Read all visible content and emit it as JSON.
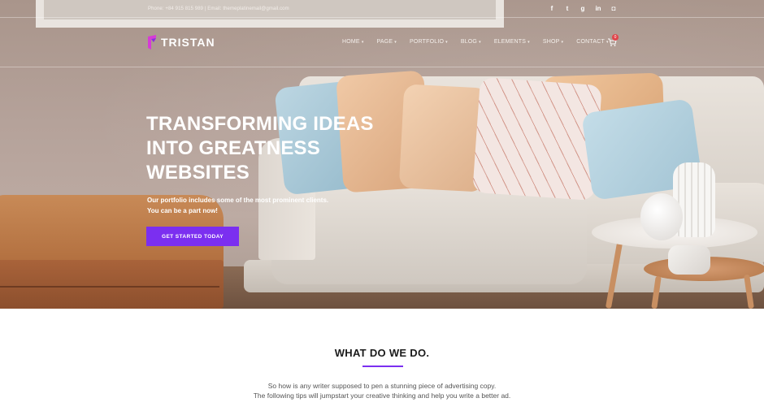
{
  "topbar": {
    "contact": "Phone: +84 915 815 989 | Email: themeplatinemail@gmail.com",
    "socials": [
      {
        "icon": "facebook-icon",
        "glyph": "f"
      },
      {
        "icon": "twitter-icon",
        "glyph": "t"
      },
      {
        "icon": "google-plus-icon",
        "glyph": "g"
      },
      {
        "icon": "linkedin-icon",
        "glyph": "in"
      },
      {
        "icon": "instagram-icon",
        "glyph": "◘"
      }
    ]
  },
  "brand": {
    "name": "TRISTAN",
    "accent": "#7b2ff0",
    "logo_color": "#d63bd6"
  },
  "nav": {
    "items": [
      "HOME",
      "PAGE",
      "PORTFOLIO",
      "BLOG",
      "ELEMENTS",
      "SHOP",
      "CONTACT"
    ],
    "caret": "▾",
    "cart_count": "0"
  },
  "hero": {
    "title_lines": [
      "TRANSFORMING IDEAS",
      "INTO GREATNESS",
      "WEBSITES"
    ],
    "subtitle_lines": [
      "Our portfolio includes some of the most prominent clients.",
      "You can be a part now!"
    ],
    "cta": "GET STARTED TODAY"
  },
  "section": {
    "title": "WHAT DO WE DO.",
    "text_lines": [
      "So how is any writer supposed to pen a stunning piece of advertising copy.",
      "The following tips will jumpstart your creative thinking and help you write a better ad."
    ]
  }
}
